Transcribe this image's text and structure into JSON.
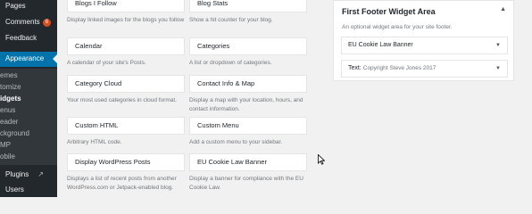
{
  "admin_menu": {
    "pages": "Pages",
    "comments": "Comments",
    "comments_count": "6",
    "feedback": "Feedback",
    "appearance": "Appearance",
    "sub_themes": "emes",
    "sub_customize": "tomize",
    "sub_widgets": "idgets",
    "sub_menus": "enus",
    "sub_header": "eader",
    "sub_background": "ckground",
    "sub_amp": "MP",
    "sub_mobile": "obile",
    "plugins": "Plugins",
    "users": "Users"
  },
  "available_widgets": [
    {
      "title": "Blogs I Follow",
      "desc": "Display linked images for the blogs you follow"
    },
    {
      "title": "Blog Stats",
      "desc": "Show a hit counter for your blog."
    },
    {
      "title": "Calendar",
      "desc": "A calendar of your site's Posts."
    },
    {
      "title": "Categories",
      "desc": "A list or dropdown of categories."
    },
    {
      "title": "Category Cloud",
      "desc": "Your most used categories in cloud format."
    },
    {
      "title": "Contact Info & Map",
      "desc": "Display a map with your location, hours, and contact information."
    },
    {
      "title": "Custom HTML",
      "desc": "Arbitrary HTML code."
    },
    {
      "title": "Custom Menu",
      "desc": "Add a custom menu to your sidebar."
    },
    {
      "title": "Display WordPress Posts",
      "desc": "Displays a list of recent posts from another WordPress.com or Jetpack-enabled blog."
    },
    {
      "title": "EU Cookie Law Banner",
      "desc": "Display a banner for compliance with the EU Cookie Law."
    }
  ],
  "widget_area": {
    "title": "First Footer Widget Area",
    "description": "An optional widget area for your site footer.",
    "widgets": [
      {
        "title": "EU Cookie Law Banner",
        "subtitle": ""
      },
      {
        "title": "Text:",
        "subtitle": "Copyright Steve Jones 2017"
      }
    ]
  },
  "icons": {
    "toggle": "triangle-up-icon",
    "widget_caret": "triangle-down-icon",
    "external": "external-link-icon"
  },
  "colors": {
    "admin_bg": "#23282d",
    "active_bg": "#0073aa",
    "badge": "#d54e21",
    "page_bg": "#f1f1f1"
  }
}
